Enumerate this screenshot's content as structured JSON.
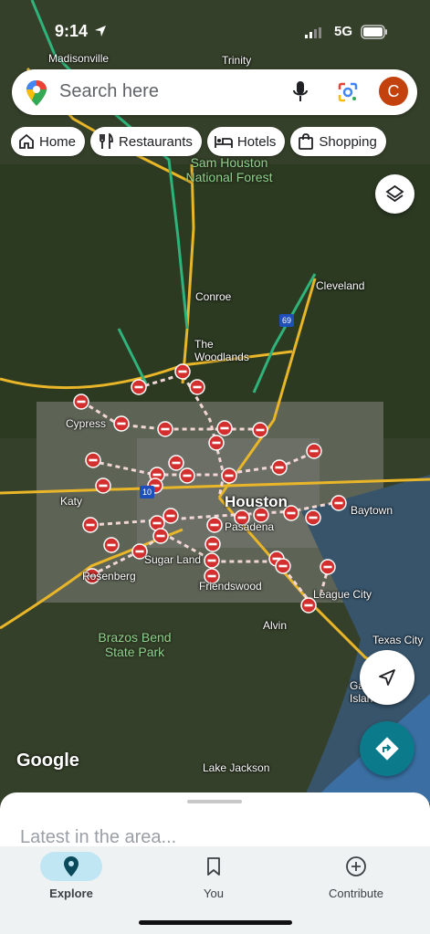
{
  "status_bar": {
    "time": "9:14",
    "network": "5G"
  },
  "search": {
    "placeholder": "Search here",
    "avatar_initial": "C"
  },
  "chips": [
    {
      "label": "Home",
      "icon": "home-icon"
    },
    {
      "label": "Restaurants",
      "icon": "restaurant-icon"
    },
    {
      "label": "Hotels",
      "icon": "hotel-icon"
    },
    {
      "label": "Shopping",
      "icon": "shopping-bag-icon"
    }
  ],
  "map": {
    "labels": {
      "madisonville": "Madisonville",
      "trinity": "Trinity",
      "forest": "Sam Houston National Forest",
      "conroe": "Conroe",
      "cleveland": "Cleveland",
      "woodlands": "The Woodlands",
      "cypress": "Cypress",
      "houston": "Houston",
      "katy": "Katy",
      "baytown": "Baytown",
      "pasadena": "Pasadena",
      "sugar_land": "Sugar Land",
      "rosenberg": "Rosenberg",
      "friendswood": "Friendswood",
      "league_city": "League City",
      "alvin": "Alvin",
      "texas_city": "Texas City",
      "galveston": "Galveston Island",
      "brazos": "Brazos Bend State Park",
      "lake_jackson": "Lake Jackson"
    },
    "road_shields": [
      "69",
      "10"
    ],
    "attribution": "Google"
  },
  "sheet": {
    "latest": "Latest in the area..."
  },
  "nav": {
    "explore": "Explore",
    "you": "You",
    "contribute": "Contribute"
  },
  "colors": {
    "closure": "#d32f2f",
    "nav_active": "#bfe6f2",
    "directions_fab": "#0b7a8a",
    "avatar": "#c2410c"
  }
}
